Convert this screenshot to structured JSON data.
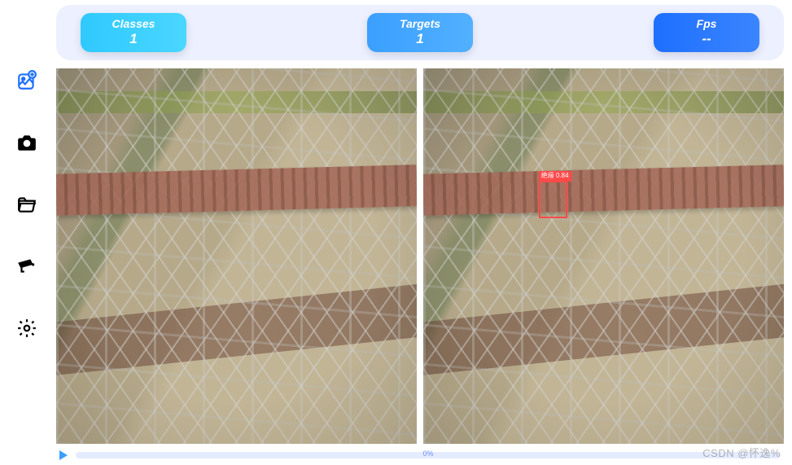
{
  "sidebar": {
    "items": [
      {
        "name": "add-image-icon"
      },
      {
        "name": "camera-icon"
      },
      {
        "name": "folder-icon"
      },
      {
        "name": "cctv-icon"
      },
      {
        "name": "gear-icon"
      }
    ]
  },
  "stats": {
    "classes": {
      "label": "Classes",
      "value": "1"
    },
    "targets": {
      "label": "Targets",
      "value": "1"
    },
    "fps": {
      "label": "Fps",
      "value": "--"
    }
  },
  "detection": {
    "label": "绝缘 0.84"
  },
  "progress": {
    "percent_label": "0%"
  },
  "watermark": "CSDN @怀逸%"
}
